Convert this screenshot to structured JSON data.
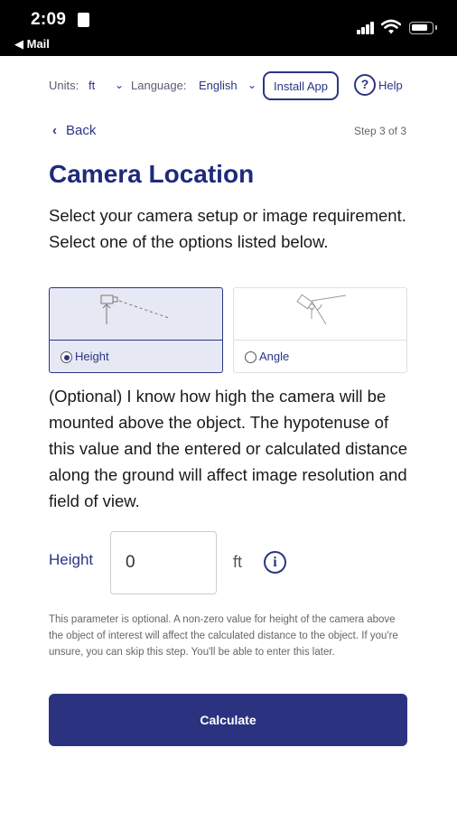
{
  "status_bar": {
    "time": "2:09",
    "back_app": "◀ Mail"
  },
  "toolbar": {
    "units_label": "Units:",
    "units_value": "ft",
    "language_label": "Language:",
    "language_value": "English",
    "install_label": "Install App",
    "help_label": "Help"
  },
  "nav": {
    "back_label": "Back",
    "step": "Step 3 of 3"
  },
  "page": {
    "title": "Camera Location",
    "intro_line1": "Select your camera setup or image requirement.",
    "intro_line2": "Select one of the options listed below."
  },
  "options": [
    {
      "label": "Height",
      "selected": true
    },
    {
      "label": "Angle",
      "selected": false
    }
  ],
  "description": "(Optional) I know how high the camera will be mounted above the object. The hypotenuse of this value and the entered or calculated distance along the ground will affect image resolution and field of view.",
  "height_field": {
    "label": "Height",
    "value": "0",
    "unit": "ft"
  },
  "note": "This parameter is optional. A non-zero value for height of the camera above the object of interest will affect the calculated distance to the object. If you're unsure, you can skip this step. You'll be able to enter this later.",
  "calculate_label": "Calculate",
  "colors": {
    "accent": "#2a3585",
    "button": "#2b3380",
    "selected_card": "#e6e8f3"
  }
}
